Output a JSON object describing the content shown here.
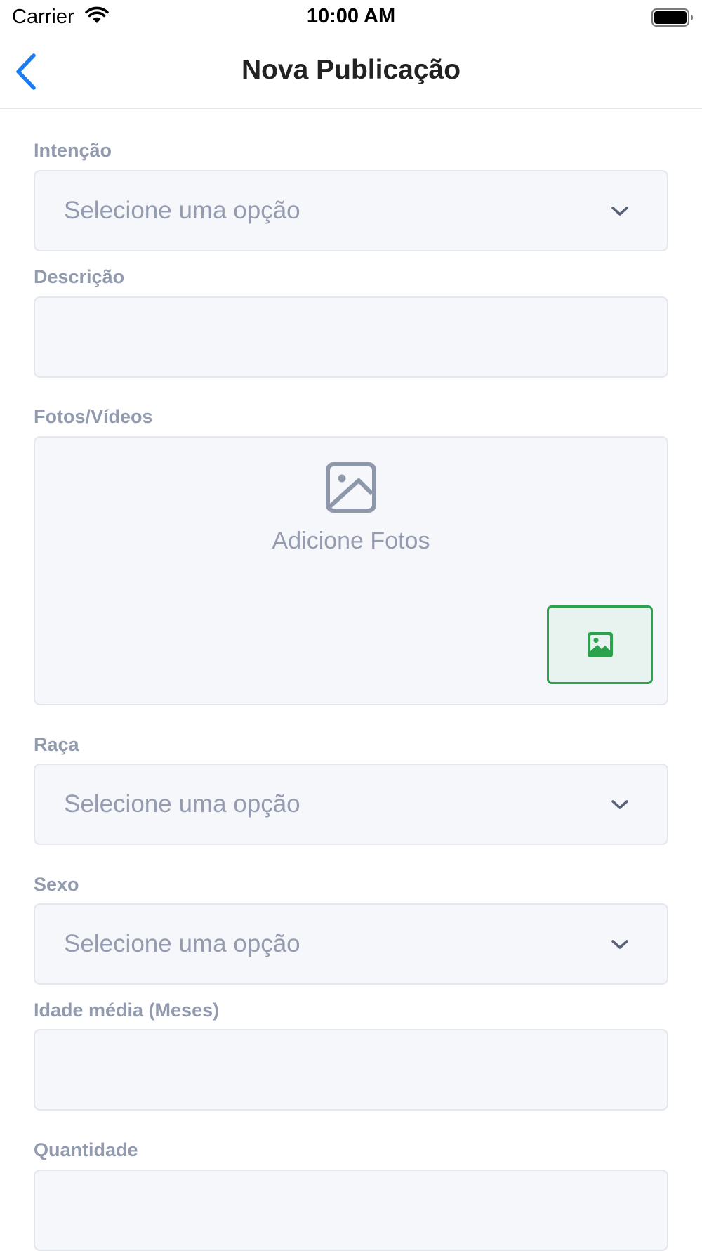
{
  "status_bar": {
    "carrier": "Carrier",
    "time": "10:00 AM"
  },
  "nav": {
    "title": "Nova Publicação",
    "back_icon": "chevron-left-icon"
  },
  "form": {
    "intencao": {
      "label": "Intenção",
      "placeholder": "Selecione uma opção",
      "value": ""
    },
    "descricao": {
      "label": "Descrição",
      "value": ""
    },
    "midia": {
      "label": "Fotos/Vídeos",
      "placeholder_text": "Adicione Fotos",
      "button_icon": "image-icon"
    },
    "raca": {
      "label": "Raça",
      "placeholder": "Selecione uma opção",
      "value": ""
    },
    "sexo": {
      "label": "Sexo",
      "placeholder": "Selecione uma opção",
      "value": ""
    },
    "idade": {
      "label": "Idade média (Meses)",
      "value": ""
    },
    "quantidade": {
      "label": "Quantidade",
      "value": ""
    }
  },
  "colors": {
    "accent_blue": "#1a7cf2",
    "accent_green": "#2ba24c",
    "label_gray": "#929aae",
    "field_background": "#f6f7fb"
  }
}
